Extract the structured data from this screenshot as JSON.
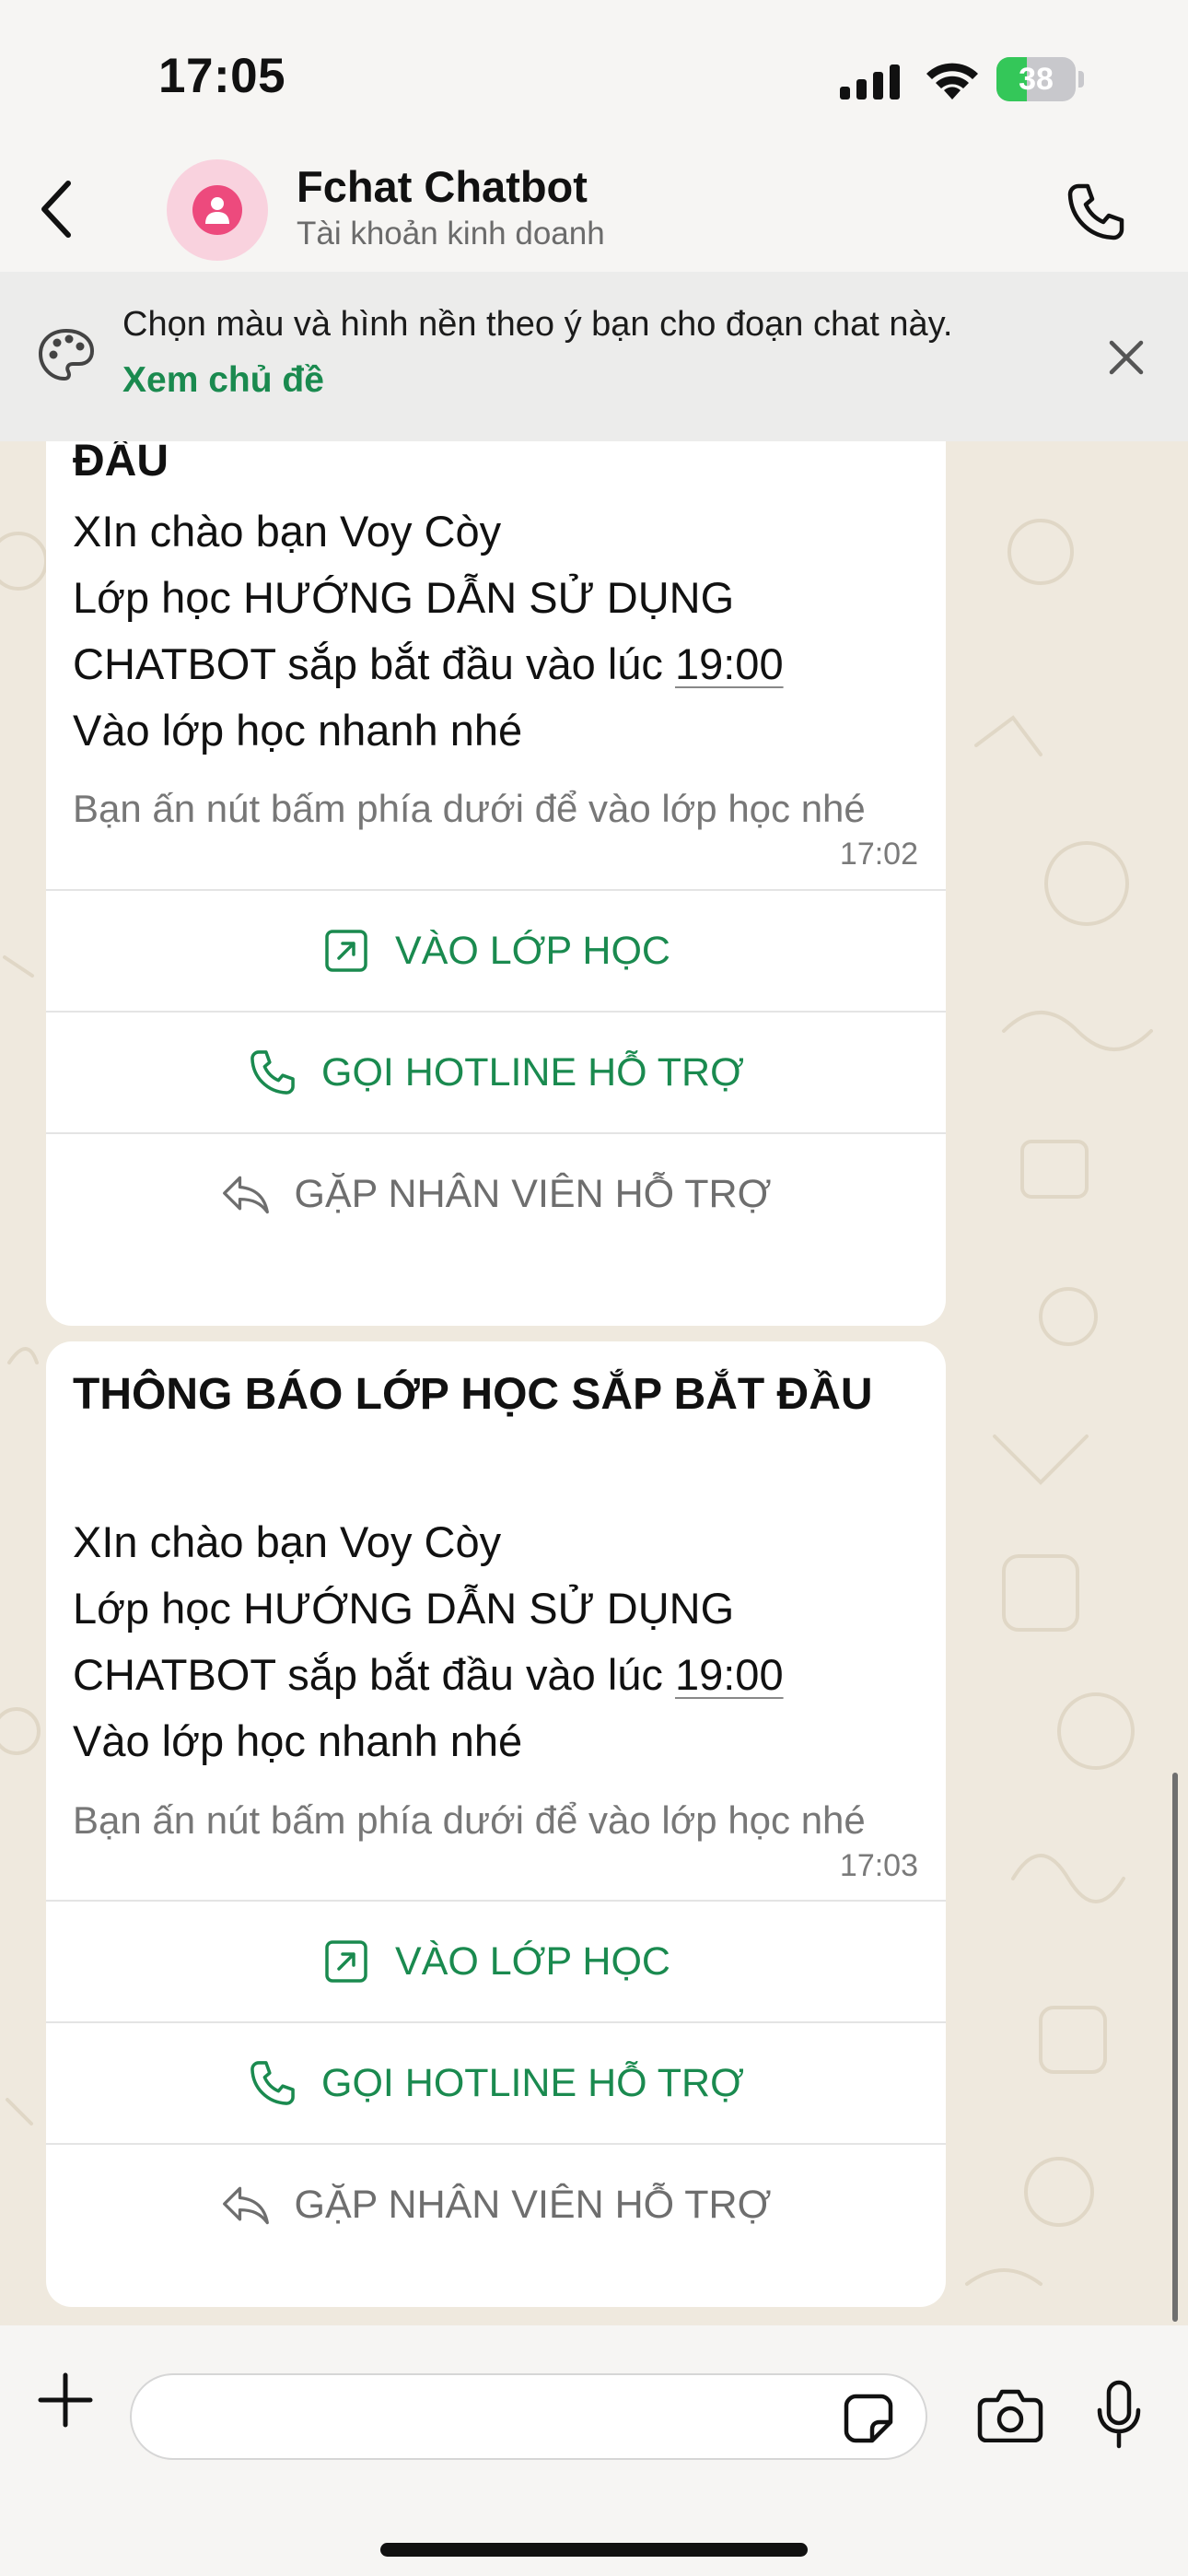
{
  "status_bar": {
    "time": "17:05",
    "battery_level": "38",
    "battery_fraction": 0.38
  },
  "header": {
    "contact_name": "Fchat Chatbot",
    "contact_subtitle": "Tài khoản kinh doanh",
    "avatar_color": "#ed4a7d"
  },
  "banner": {
    "text": "Chọn màu và hình nền theo ý bạn cho đoạn chat này.",
    "link": "Xem chủ đề"
  },
  "messages": [
    {
      "title": "ĐẦU",
      "line1": "XIn chào bạn Voy Còy",
      "line2": "Lớp học HƯỚNG DẪN SỬ DỤNG",
      "line3_prefix": "CHATBOT sắp bắt đầu vào lúc ",
      "line3_time": "19:00",
      "line4": "Vào lớp học nhanh nhé",
      "footer": "Bạn ấn nút bấm phía dưới để vào lớp học nhé",
      "time": "17:02",
      "buttons": [
        "VÀO LỚP HỌC",
        "GỌI HOTLINE HỖ TRỢ",
        "GẶP NHÂN VIÊN HỖ TRỢ"
      ]
    },
    {
      "title": "THÔNG BÁO LỚP HỌC SẮP BẮT ĐẦU",
      "line1": "XIn chào bạn Voy Còy",
      "line2": "Lớp học HƯỚNG DẪN SỬ DỤNG",
      "line3_prefix": "CHATBOT sắp bắt đầu vào lúc ",
      "line3_time": "19:00",
      "line4": "Vào lớp học nhanh nhé",
      "footer": "Bạn ấn nút bấm phía dưới để vào lớp học nhé",
      "time": "17:03",
      "buttons": [
        "VÀO LỚP HỌC",
        "GỌI HOTLINE HỖ TRỢ",
        "GẶP NHÂN VIÊN HỖ TRỢ"
      ]
    }
  ],
  "composer": {
    "placeholder": ""
  },
  "colors": {
    "accent_green": "#1a8a4f",
    "chat_background": "#efe9de",
    "bubble": "#ffffff"
  }
}
